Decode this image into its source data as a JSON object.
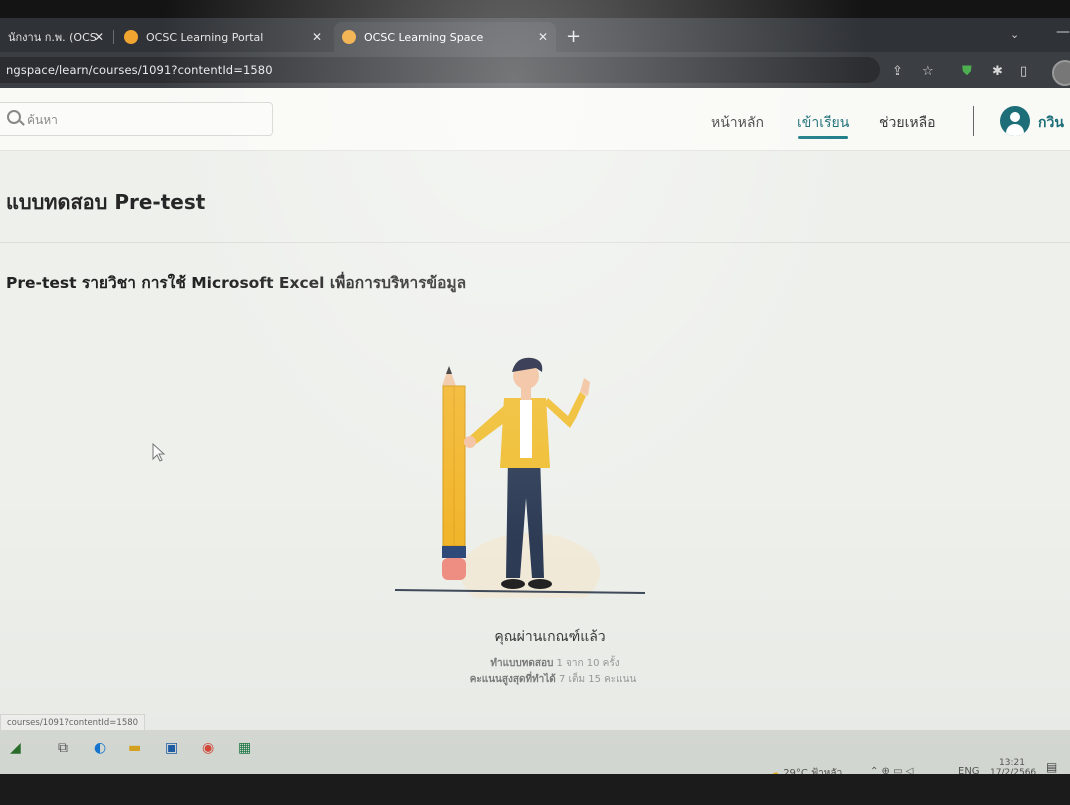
{
  "browser": {
    "tabs": [
      {
        "title": "นักงาน ก.พ. (OCS",
        "close": "✕"
      },
      {
        "title": "OCSC Learning Portal",
        "close": "✕"
      },
      {
        "title": "OCSC Learning Space",
        "close": "✕"
      }
    ],
    "new_tab": "+",
    "tab_list": "⌄",
    "minimize": "—",
    "url": "ngspace/learn/courses/1091?contentId=1580"
  },
  "header": {
    "search_placeholder": "ค้นหา",
    "nav": [
      "หน้าหลัก",
      "เข้าเรียน",
      "ช่วยเหลือ"
    ],
    "active_nav": "เข้าเรียน",
    "user_name": "กวิน"
  },
  "page": {
    "title": "แบบทดสอบ Pre-test",
    "exam_name": "Pre-test รายวิชา การใช้ Microsoft Excel เพื่อการบริหารข้อมูล",
    "result_title": "คุณผ่านเกณฑ์แล้ว",
    "attempts_label": "ทำแบบทดสอบ",
    "attempts_value": "1 จาก 10 ครั้ง",
    "score_label": "คะแนนสูงสุดที่ทำได้",
    "score_value": "7 เต็ม 15 คะแนน"
  },
  "status_url": "courses/1091?contentId=1580",
  "taskbar": {
    "weather": "29°C ฟ้าหลัว",
    "language": "ENG",
    "time": "13:21",
    "date": "17/2/2566"
  },
  "colors": {
    "accent": "#1d6e78",
    "tab_bg": "#2f3236",
    "page_bg": "#eef0ec"
  }
}
